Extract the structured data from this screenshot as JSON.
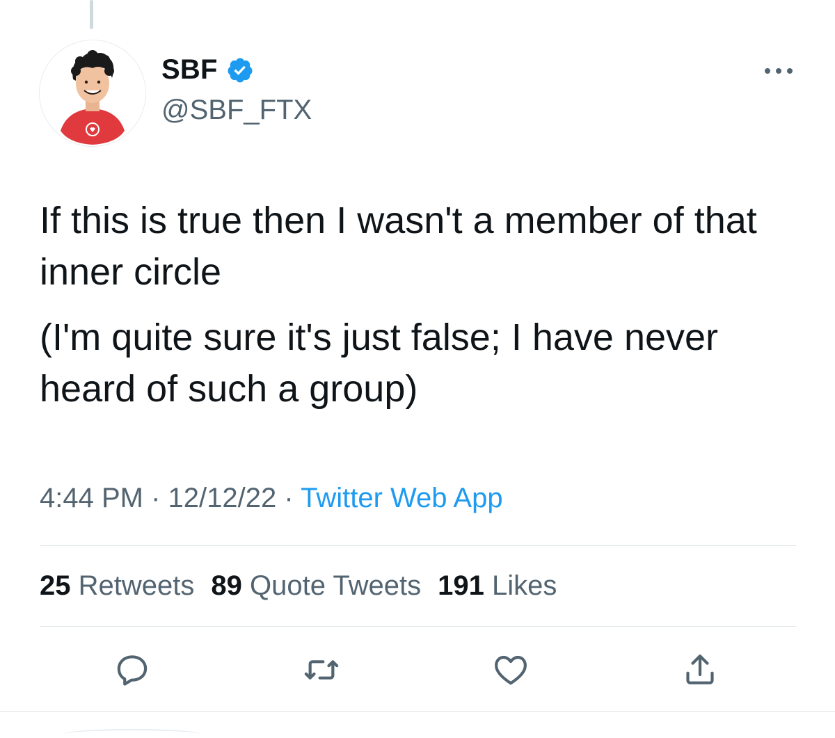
{
  "author": {
    "display_name": "SBF",
    "handle": "@SBF_FTX",
    "verified": true
  },
  "tweet": {
    "paragraphs": [
      "If this is true then I wasn't a member of that inner circle",
      "(I'm quite sure it's just false; I have never heard of such a group)"
    ],
    "time": "4:44 PM",
    "date": "12/12/22",
    "separator": "·",
    "source": "Twitter Web App"
  },
  "stats": {
    "retweets_count": "25",
    "retweets_label": "Retweets",
    "quotes_count": "89",
    "quotes_label": "Quote Tweets",
    "likes_count": "191",
    "likes_label": "Likes"
  },
  "actions": {
    "reply_icon": "reply-icon",
    "retweet_icon": "retweet-icon",
    "like_icon": "heart-icon",
    "share_icon": "share-icon"
  },
  "colors": {
    "accent": "#1d9bf0",
    "secondary_text": "#536471",
    "primary_text": "#0f1419",
    "icon_gray": "#536471"
  }
}
